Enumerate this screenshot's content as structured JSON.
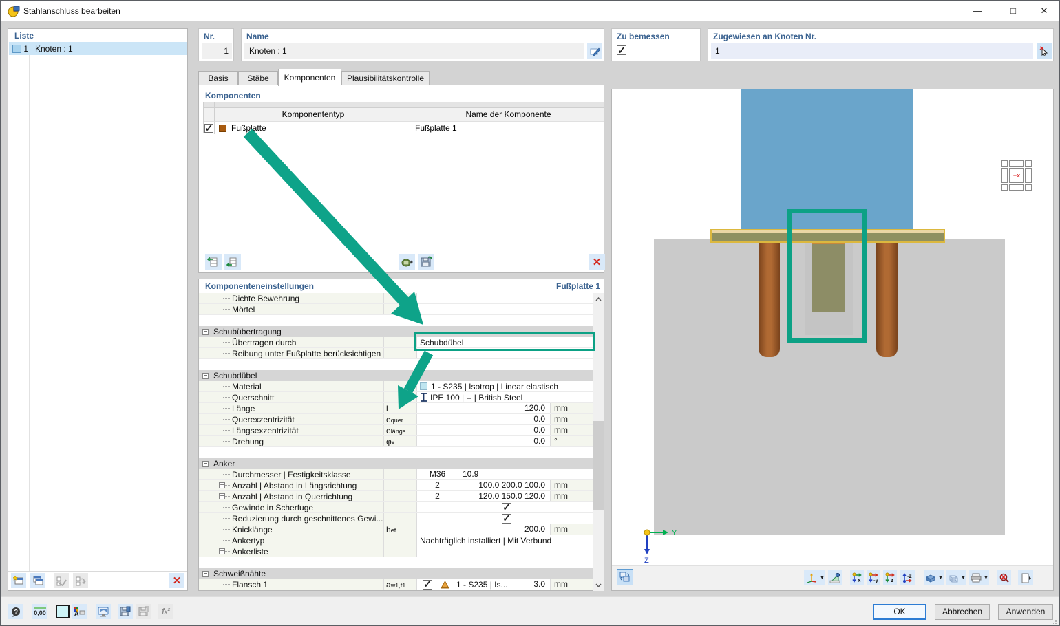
{
  "window": {
    "title": "Stahlanschluss bearbeiten"
  },
  "icons": {
    "minimize": "—",
    "maximize": "□",
    "close": "✕",
    "check": "✓",
    "collapse": "−",
    "expand": "+",
    "red_x": "✕",
    "up": "˄",
    "down": "˅",
    "dropdown": "▼"
  },
  "colors": {
    "teal": "#0CA185",
    "label_blue": "#1A5796",
    "selection": "#CBE5F7",
    "column_blue": "#6AA5CB",
    "plate_olive": "#8F9060",
    "plate_border": "#DCB83E",
    "concrete": "#CACACA",
    "anchor_brown": "#A35E2C",
    "dowel_olive": "#8D8D66"
  },
  "liste": {
    "label": "Liste",
    "item": {
      "num": "1",
      "name": "Knoten : 1"
    }
  },
  "fields": {
    "nr_label": "Nr.",
    "nr_value": "1",
    "name_label": "Name",
    "name_value": "Knoten : 1",
    "zu_bemessen_label": "Zu bemessen",
    "zugewiesen_label": "Zugewiesen an Knoten Nr.",
    "zugewiesen_value": "1"
  },
  "tabs": [
    {
      "label": "Basis"
    },
    {
      "label": "Stäbe"
    },
    {
      "label": "Komponenten"
    },
    {
      "label": "Plausibilitätskontrolle"
    }
  ],
  "komponenten": {
    "section_label": "Komponenten",
    "col_typ": "Komponententyp",
    "col_name": "Name der Komponente",
    "row": {
      "typ": "Fußplatte",
      "name": "Fußplatte 1"
    }
  },
  "einstellungen": {
    "section_label": "Komponenteneinstellungen",
    "context_label": "Fußplatte 1",
    "rows": [
      {
        "type": "check",
        "label": "Dichte Bewehrung",
        "checked": false
      },
      {
        "type": "check",
        "label": "Mörtel",
        "checked": false
      },
      {
        "type": "spacer"
      },
      {
        "type": "group",
        "label": "Schubübertragung"
      },
      {
        "type": "text",
        "label": "Übertragen durch",
        "value": "Schubdübel",
        "annotated": true
      },
      {
        "type": "check",
        "label": "Reibung unter Fußplatte berücksichtigen",
        "checked": false
      },
      {
        "type": "spacer"
      },
      {
        "type": "group",
        "label": "Schubdübel"
      },
      {
        "type": "text",
        "label": "Material",
        "icon": "material-swatch",
        "value": "1 - S235 | Isotrop | Linear elastisch"
      },
      {
        "type": "text",
        "label": "Querschnitt",
        "icon": "i-section",
        "value": "IPE 100 | -- | British Steel"
      },
      {
        "type": "value",
        "label": "Länge",
        "sym_b": "l",
        "sym_s": "",
        "value": "120.0",
        "unit": "mm"
      },
      {
        "type": "value",
        "label": "Querexzentrizität",
        "sym_b": "e",
        "sym_s": "quer",
        "value": "0.0",
        "unit": "mm"
      },
      {
        "type": "value",
        "label": "Längsexzentrizität",
        "sym_b": "e",
        "sym_s": "längs",
        "value": "0.0",
        "unit": "mm"
      },
      {
        "type": "value",
        "label": "Drehung",
        "sym_b": "φ",
        "sym_s": "x",
        "value": "0.0",
        "unit": "°"
      },
      {
        "type": "spacer"
      },
      {
        "type": "group",
        "label": "Anker"
      },
      {
        "type": "pair",
        "label": "Durchmesser | Festigkeitsklasse",
        "c1": "M36",
        "c2": "10.9",
        "c2align": "left",
        "unit": ""
      },
      {
        "type": "pair",
        "label": "Anzahl | Abstand in Längsrichtung",
        "expand": true,
        "c1": "2",
        "c2": "100.0 200.0 100.0",
        "c2align": "right",
        "unit": "mm"
      },
      {
        "type": "pair",
        "label": "Anzahl | Abstand in Querrichtung",
        "expand": true,
        "c1": "2",
        "c2": "120.0 150.0 120.0",
        "c2align": "right",
        "unit": "mm"
      },
      {
        "type": "check",
        "label": "Gewinde in Scherfuge",
        "checked": true
      },
      {
        "type": "check",
        "label": "Reduzierung durch geschnittenes Gewi...",
        "checked": true
      },
      {
        "type": "value",
        "label": "Knicklänge",
        "sym_b": "h",
        "sym_s": "ef",
        "value": "200.0",
        "unit": "mm"
      },
      {
        "type": "text",
        "label": "Ankertyp",
        "value": "Nachträglich installiert | Mit Verbund"
      },
      {
        "type": "text",
        "label": "Ankerliste",
        "expand": true,
        "value": ""
      },
      {
        "type": "spacer"
      },
      {
        "type": "group",
        "label": "Schweißnähte"
      },
      {
        "type": "weld",
        "label": "Flansch 1",
        "sym_b": "a",
        "sym_s": "w1,f1",
        "checked": true,
        "material": "1 - S235 | Is...",
        "value": "3.0",
        "unit": "mm"
      }
    ]
  },
  "dialog_buttons": {
    "ok": "OK",
    "cancel": "Abbrechen",
    "apply": "Anwenden"
  },
  "nav_widget": {
    "center": "+x"
  },
  "axes": {
    "y": "Y",
    "z": "Z"
  }
}
